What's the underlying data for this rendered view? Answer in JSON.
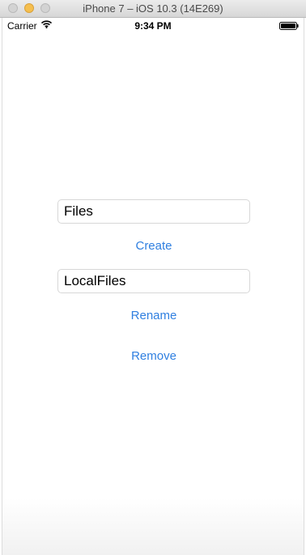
{
  "window": {
    "title": "iPhone 7 – iOS 10.3 (14E269)"
  },
  "status_bar": {
    "carrier": "Carrier",
    "time": "9:34 PM",
    "icons": [
      "wifi-icon",
      "battery-icon"
    ]
  },
  "form": {
    "folder_field_value": "Files",
    "create_label": "Create",
    "rename_field_value": "LocalFiles",
    "rename_label": "Rename",
    "remove_label": "Remove"
  },
  "colors": {
    "tint": "#2f7fe0",
    "background": "#ffffff"
  }
}
